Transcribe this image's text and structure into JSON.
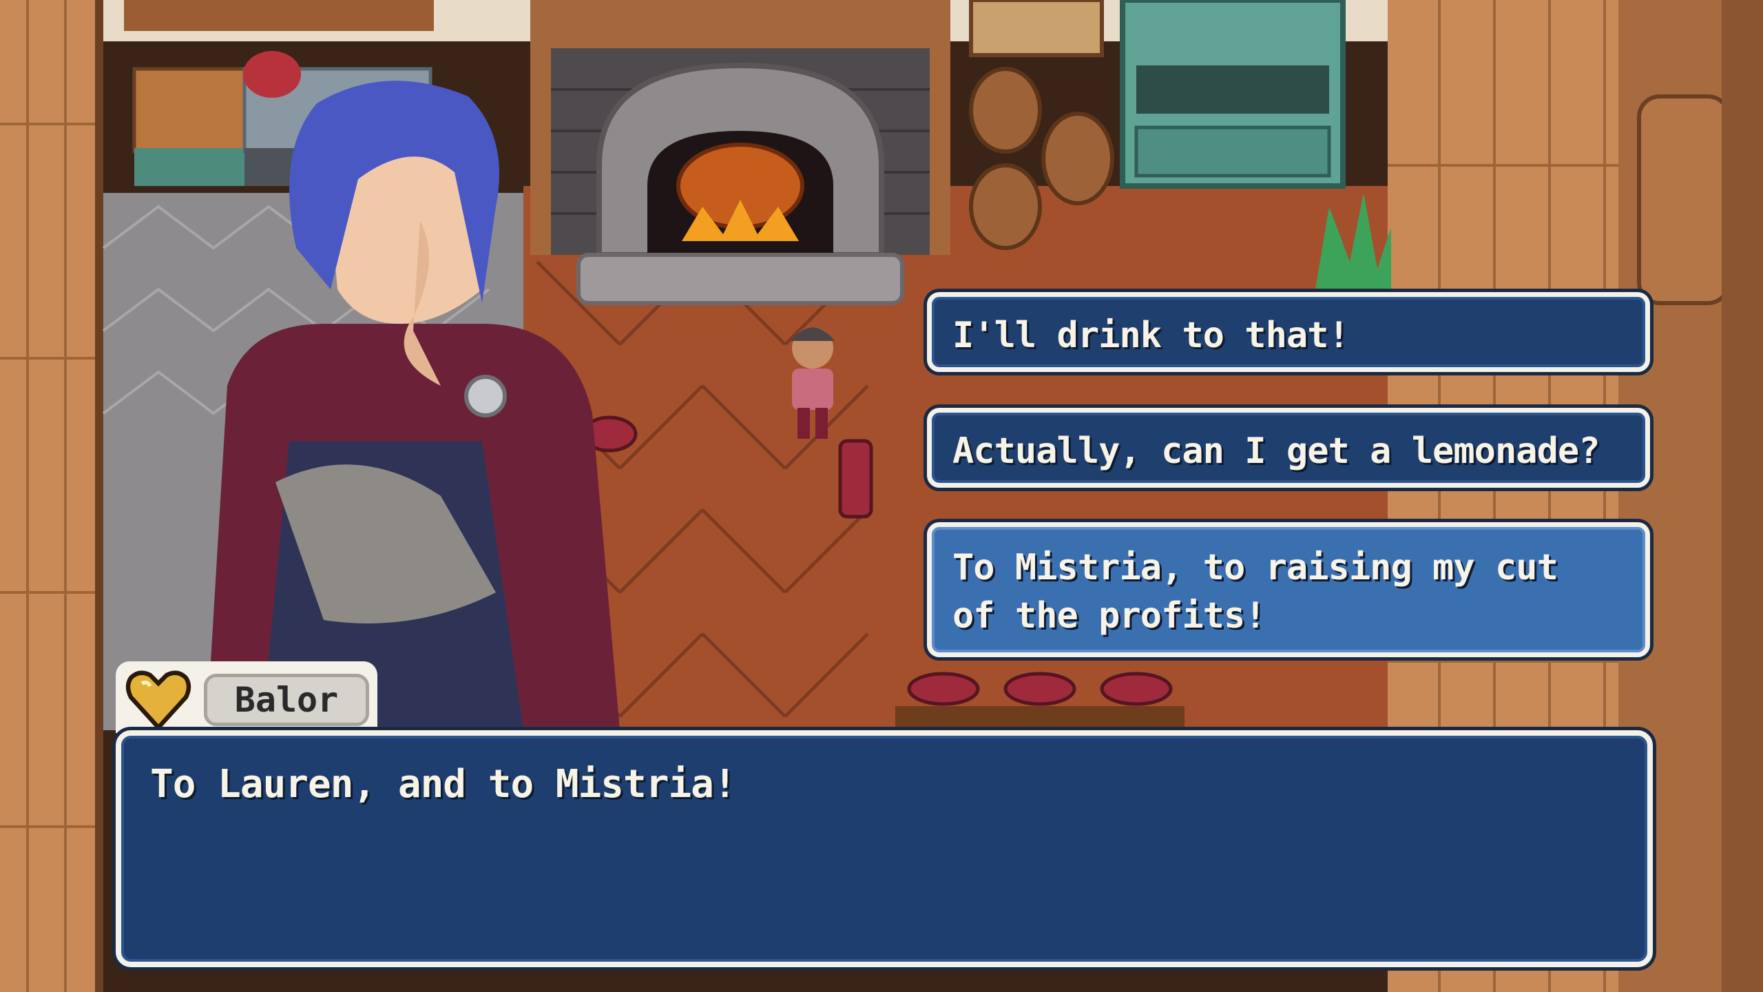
{
  "speaker": {
    "name": "Balor",
    "icon": "heart-icon",
    "icon_color": "#e4b23a"
  },
  "dialogue": {
    "text": "To Lauren, and to Mistria!"
  },
  "choices": [
    {
      "lines": [
        "I'll drink to that!"
      ],
      "selected": false
    },
    {
      "lines": [
        "Actually, can I get a lemonade?"
      ],
      "selected": false
    },
    {
      "lines": [
        "To Mistria, to raising my cut",
        "of the profits!"
      ],
      "selected": true
    }
  ],
  "colors": {
    "dialogue_bg": "#1d3e6e",
    "choice_bg": "#1f3f6e",
    "choice_selected_bg": "#3a6fb0",
    "border": "#f4f1e8",
    "floor": "#a4502c"
  }
}
